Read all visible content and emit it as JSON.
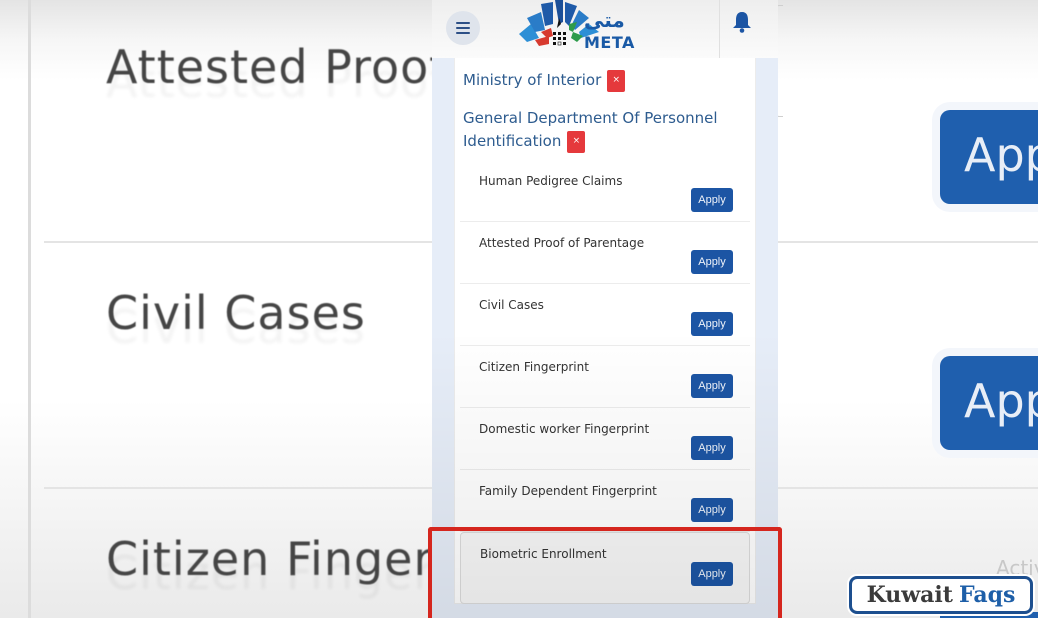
{
  "background": {
    "rows": [
      {
        "title": "Attested Proof",
        "button": "App"
      },
      {
        "title": "Civil Cases",
        "button": "App"
      },
      {
        "title": "Citizen Fingerp",
        "button": ""
      }
    ],
    "activation_watermark": "Activ"
  },
  "header": {
    "menu_icon": "hamburger-icon",
    "logo_arabic": "متى",
    "logo_english": "META",
    "notification_icon": "bell-icon"
  },
  "breadcrumbs": [
    {
      "label": "Ministry of Interior",
      "remove": "×"
    },
    {
      "label": "General Department Of Personnel Identification",
      "remove": "×"
    }
  ],
  "services": [
    {
      "name": "Human Pedigree Claims",
      "action": "Apply"
    },
    {
      "name": "Attested Proof of Parentage",
      "action": "Apply"
    },
    {
      "name": "Civil Cases",
      "action": "Apply"
    },
    {
      "name": "Citizen Fingerprint",
      "action": "Apply"
    },
    {
      "name": "Domestic worker Fingerprint",
      "action": "Apply"
    },
    {
      "name": "Family Dependent Fingerprint",
      "action": "Apply"
    },
    {
      "name": "Biometric Enrollment",
      "action": "Apply",
      "highlighted": true
    }
  ],
  "watermark": {
    "part1": "Kuwait",
    "part2": "Faqs"
  },
  "colors": {
    "primary_button": "#1c55a4",
    "breadcrumb_text": "#2e5c8f",
    "remove_badge": "#e5393c",
    "highlight_frame": "#d5261e"
  }
}
